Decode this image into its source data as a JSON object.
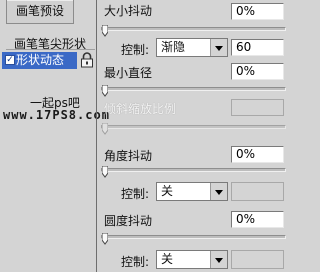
{
  "left": {
    "preset_button": "画笔预设",
    "tip_shape": "画笔笔尖形状",
    "shape_dynamics": "形状动态",
    "watermark_line1": "一起ps吧",
    "watermark_line2": "www.17PS8.com"
  },
  "size_jitter": {
    "label": "大小抖动",
    "value": "0%"
  },
  "size_control": {
    "label": "控制:",
    "selected": "渐隐",
    "value": "60"
  },
  "min_diameter": {
    "label": "最小直径",
    "value": "0%"
  },
  "tilt_scale": {
    "label": "倾斜缩放比例",
    "value": ""
  },
  "angle_jitter": {
    "label": "角度抖动",
    "value": "0%"
  },
  "angle_control": {
    "label": "控制:",
    "selected": "关",
    "value": ""
  },
  "roundness_jitter": {
    "label": "圆度抖动",
    "value": "0%"
  },
  "roundness_control": {
    "label": "控制:",
    "selected": "关"
  },
  "sliders": {
    "size_jitter": 0,
    "min_diameter": 0,
    "tilt_scale": 0,
    "angle_jitter": 0,
    "roundness_jitter": 0
  },
  "icons": {
    "lock": "lock-icon",
    "checkbox": "checkmark-icon",
    "thumb": "slider-thumb-icon"
  }
}
